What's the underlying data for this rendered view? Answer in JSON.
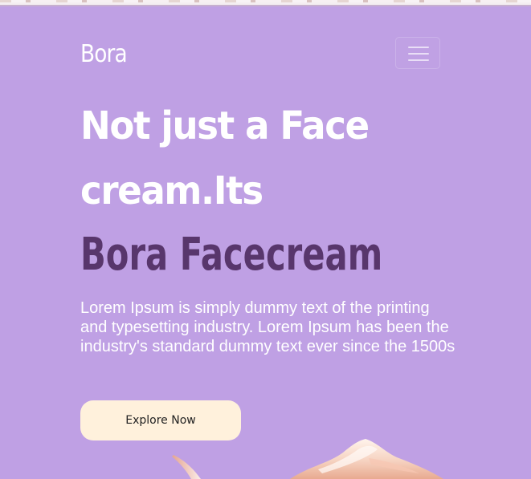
{
  "header": {
    "brand": "Bora"
  },
  "hero": {
    "headline_line_1": "Not just a Face",
    "headline_line_2": "cream.Its",
    "product_name": "Bora Facecream",
    "description": "Lorem Ipsum is simply dummy text of the printing and typesetting industry. Lorem Ipsum has been the industry's standard dummy text ever since the 1500s",
    "button_label": "Explore Now"
  },
  "icons": {
    "menu": "hamburger-icon"
  },
  "colors": {
    "background": "#bfa0e4",
    "headline": "#ffffff",
    "accent_text": "#58366c",
    "button_background": "#fff1dc",
    "button_text": "#222222"
  }
}
